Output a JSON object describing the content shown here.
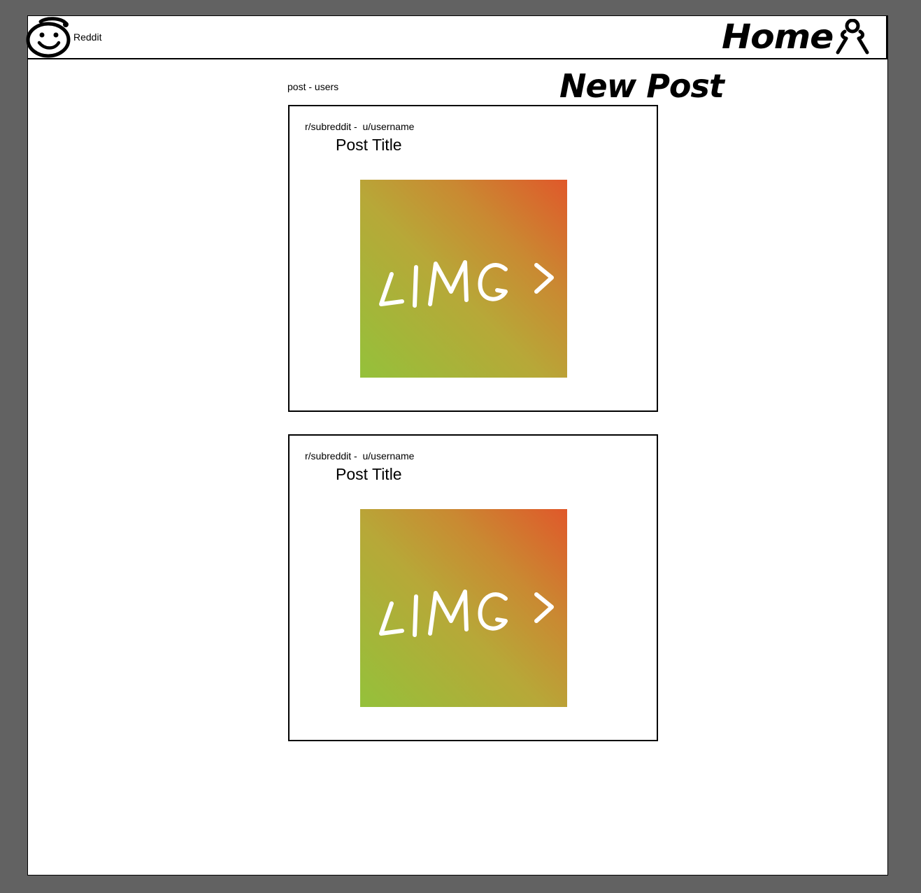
{
  "header": {
    "brand": "Reddit",
    "home_label": "Home"
  },
  "main": {
    "feed_label": "post - users",
    "new_post_label": "New Post",
    "posts": [
      {
        "meta": "r/subreddit -  u/username",
        "title": "Post Title",
        "image_label": "<IMG>"
      },
      {
        "meta": "r/subreddit -  u/username",
        "title": "Post Title",
        "image_label": "<IMG>"
      }
    ]
  },
  "colors": {
    "background": "#626262",
    "artboard": "#ffffff",
    "image_gradient": [
      "#94c13a",
      "#e0582a"
    ]
  },
  "icons": [
    "smiley-logo-icon",
    "user-icon"
  ]
}
